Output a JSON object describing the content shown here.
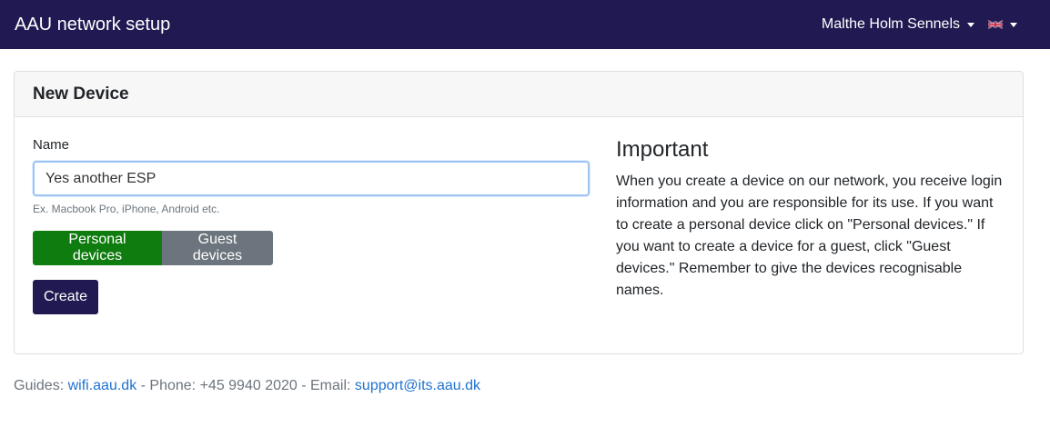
{
  "navbar": {
    "brand": "AAU network setup",
    "user": "Malthe Holm Sennels",
    "language_icon": "uk-flag-icon",
    "background": "#211a52"
  },
  "card": {
    "title": "New Device",
    "name_label": "Name",
    "name_value": "Yes another ESP",
    "name_help": "Ex. Macbook Pro, iPhone, Android etc.",
    "personal_button": "Personal devices",
    "guest_button": "Guest devices",
    "create_button": "Create",
    "important_title": "Important",
    "important_text": "When you create a device on our network, you receive login information and you are responsible for its use. If you want to create a personal device click on \"Personal devices.\" If you want to create a device for a guest, click \"Guest devices.\" Remember to give the devices recognisable names."
  },
  "footer": {
    "guides_label": "Guides:",
    "guides_link": "wifi.aau.dk",
    "phone_text": "- Phone: +45 9940 2020 - Email:",
    "email_link": "support@its.aau.dk"
  },
  "colors": {
    "personal": "#0f7c0f",
    "guest": "#6c757d",
    "primary": "#211a52",
    "link": "#1f72cf"
  }
}
